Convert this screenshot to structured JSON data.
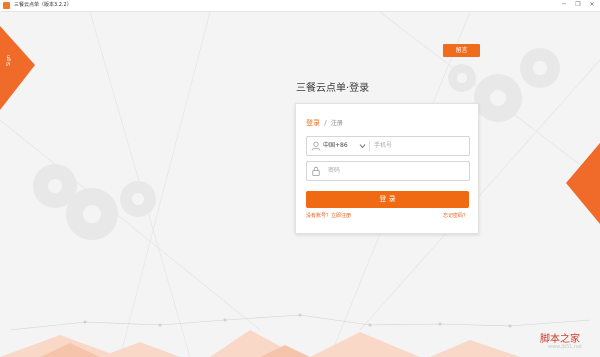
{
  "window": {
    "title": "三餐云点单（版本3.2.2）",
    "controls": [
      "─",
      "❐",
      "✕"
    ]
  },
  "left_tab_text": "Sign",
  "feedback_label": "留言",
  "heading": "三餐云点单·登录",
  "tabs": {
    "login": "登录",
    "separator": "/",
    "register": "注册"
  },
  "phone": {
    "country_code": "中国+86",
    "placeholder": "手机号",
    "value": ""
  },
  "password": {
    "placeholder": "密码",
    "value": ""
  },
  "login_button": "登 录",
  "links": {
    "no_account": "没有账号？立即注册",
    "forgot_password": "忘记密码？"
  },
  "colors": {
    "accent": "#ef6c1c",
    "accent_button": "#f06a13",
    "background": "#f4f4f4"
  },
  "watermark": {
    "text": "脚本之家",
    "url": "www.jb51.net"
  }
}
